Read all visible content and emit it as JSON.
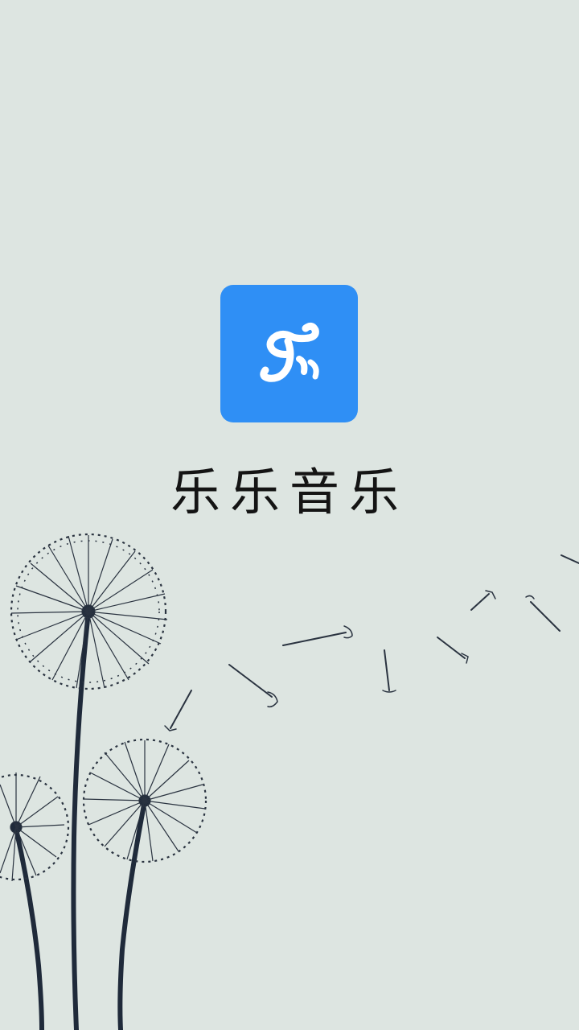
{
  "app": {
    "name": "乐乐音乐",
    "logo_text": "乐",
    "logo_icon": "music-logo-icon",
    "accent_color": "#2f8ff5"
  },
  "background": {
    "color": "#dde5e1",
    "art": "dandelion-illustration"
  }
}
